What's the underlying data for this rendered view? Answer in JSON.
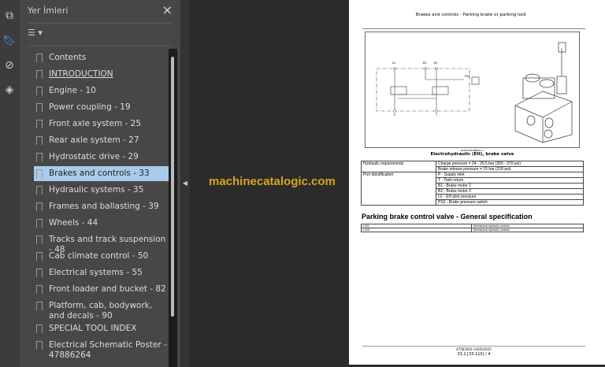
{
  "panel": {
    "title": "Yer İmleri",
    "close": "×",
    "options_icon": "list-options-icon"
  },
  "bookmarks": [
    {
      "label": "Contents"
    },
    {
      "label": "INTRODUCTION"
    },
    {
      "label": "Engine - 10"
    },
    {
      "label": "Power coupling - 19"
    },
    {
      "label": "Front axle system - 25"
    },
    {
      "label": "Rear axle system - 27"
    },
    {
      "label": "Hydrostatic drive - 29"
    },
    {
      "label": "Brakes and controls - 33"
    },
    {
      "label": "Hydraulic systems - 35"
    },
    {
      "label": "Frames and ballasting - 39"
    },
    {
      "label": "Wheels - 44"
    },
    {
      "label": "Tracks and track suspension - 48"
    },
    {
      "label": "Cab climate control - 50"
    },
    {
      "label": "Electrical systems - 55"
    },
    {
      "label": "Front loader and bucket - 82"
    },
    {
      "label": "Platform, cab, bodywork, and decals - 90"
    },
    {
      "label": "SPECIAL TOOL INDEX"
    },
    {
      "label": "Electrical Schematic Poster  - 47886264"
    }
  ],
  "watermark": "machinecatalogic.com",
  "doc": {
    "header": "Brakes and controls - Parking brake or parking lock",
    "fig_labels": {
      "lv": "LV",
      "b2": "B2",
      "b1": "B1",
      "ps2": "PS2",
      "p": "P",
      "t": "T",
      "ref": "RAPH12DLMB054   1"
    },
    "caption": "Electrohydraulic (EH), brake valve",
    "table": [
      {
        "k": "Hydraulic requirements",
        "v": [
          "Charge pressure = 24 - 25.5 bar (350 - 370 psi)",
          "Brake release pressure = 15 bar (218 psi)"
        ]
      },
      {
        "k": "Port identification",
        "v": [
          "P - Supply inlet",
          "T - Tank return",
          "B1 - Brake motor 1",
          "B2 - Brake motor 2",
          "LV - EH pilot pressure",
          "PS2 - Brake pressure switch"
        ]
      }
    ],
    "heading": "Parking brake control valve - General specification",
    "spec": [
      {
        "k": "L201",
        "v": "Mechanical hydraulic controls"
      },
      {
        "k": "L205",
        "v": "Mechanical hydraulic controls"
      }
    ],
    "footer1": "47581950 14/05/2015",
    "footer2": "33.1 [33.110] / 4"
  }
}
